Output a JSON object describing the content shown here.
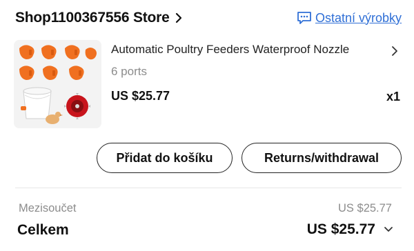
{
  "store": {
    "name": "Shop1100367556 Store",
    "other_products_label": "Ostatní výrobky",
    "accent_color": "#2f6fd6"
  },
  "item": {
    "title": "Automatic Poultry Feeders Waterproof Nozzle",
    "variant": "6 ports",
    "price": "US $25.77",
    "quantity": "x1"
  },
  "actions": {
    "add_to_cart": "Přidat do košíku",
    "returns": "Returns/withdrawal"
  },
  "summary": {
    "subtotal_label": "Mezisoučet",
    "subtotal_value": "US $25.77",
    "total_label": "Celkem",
    "total_value": "US $25.77"
  },
  "icons": {
    "store_chevron": "chevron-right-icon",
    "other_products": "chat-bubble-icon",
    "product_chevron": "chevron-right-icon",
    "total_toggle": "chevron-down-icon"
  }
}
